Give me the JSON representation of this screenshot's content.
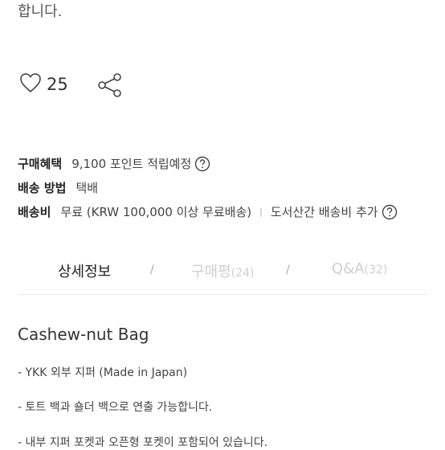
{
  "top_text": "합니다.",
  "like": {
    "count": "25"
  },
  "info": {
    "benefit": {
      "label": "구매혜택",
      "value": "9,100 포인트 적립예정"
    },
    "method": {
      "label": "배송 방법",
      "value": "택배"
    },
    "fee": {
      "label": "배송비",
      "value": "무료 (KRW 100,000 이상 무료배송)",
      "extra": "도서산간 배송비 추가"
    },
    "separator": "|"
  },
  "tabs": [
    {
      "label": "상세정보",
      "count": ""
    },
    {
      "label": "구매평",
      "count": "(24)"
    },
    {
      "label": "Q&A",
      "count": "(32)"
    }
  ],
  "tab_divider": "/",
  "product": {
    "title": "Cashew-nut Bag",
    "lines": [
      "- YKK 외부 지퍼 (Made in Japan)",
      "- 토트 백과 숄더 백으로 연출 가능합니다.",
      "- 내부 지퍼 포켓과 오픈형 포켓이 포함되어 있습니다."
    ]
  },
  "colors": {
    "active_tab": "#222222",
    "inactive_tab": "#cfcfcf",
    "divider": "#e6e6e6"
  }
}
